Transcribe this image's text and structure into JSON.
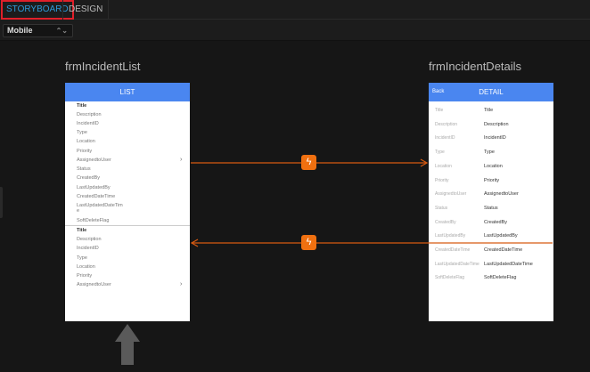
{
  "tabs": [
    {
      "label": "STORYBOARD",
      "active": true
    },
    {
      "label": "DESIGN",
      "active": false
    }
  ],
  "device_select": {
    "value": "Mobile"
  },
  "accent": "#4a86f0",
  "connector_color": "#f07010",
  "list_form": {
    "name": "frmIncidentList",
    "header": "LIST",
    "group1": [
      "Title",
      "Description",
      "IncidentID",
      "Type",
      "Location",
      "Priority",
      "AssignedtoUser",
      "Status",
      "CreatedBy",
      "LastUpdatedBy",
      "CreatedDateTime",
      "LastUpdatedDateTim",
      "e",
      "SoftDeleteFlag"
    ],
    "group2": [
      "Title",
      "Description",
      "IncidentID",
      "Type",
      "Location",
      "Priority",
      "AssignedtoUser"
    ]
  },
  "detail_form": {
    "name": "frmIncidentDetails",
    "header": "DETAIL",
    "back": "Back",
    "rows": [
      {
        "label": "Title",
        "value": "Title"
      },
      {
        "label": "Description",
        "value": "Description"
      },
      {
        "label": "IncidentID",
        "value": "IncidentID"
      },
      {
        "label": "Type",
        "value": "Type"
      },
      {
        "label": "Location",
        "value": "Location"
      },
      {
        "label": "Priority",
        "value": "Priority"
      },
      {
        "label": "AssignedtoUser",
        "value": "AssignedtoUser"
      },
      {
        "label": "Status",
        "value": "Status"
      },
      {
        "label": "CreatedBy",
        "value": "CreatedBy"
      },
      {
        "label": "LastUpdatedBy",
        "value": "LastUpdatedBy"
      },
      {
        "label": "CreatedDateTime",
        "value": "CreatedDateTime"
      },
      {
        "label": "LastUpdatedDateTime",
        "value": "LastUpdatedDateTime"
      },
      {
        "label": "SoftDeleteFlag",
        "value": "SoftDeleteFlag"
      }
    ]
  },
  "icons": {
    "connector": "lightning-icon",
    "chevron": "chevron-right-icon",
    "entry": "up-arrow-icon"
  }
}
